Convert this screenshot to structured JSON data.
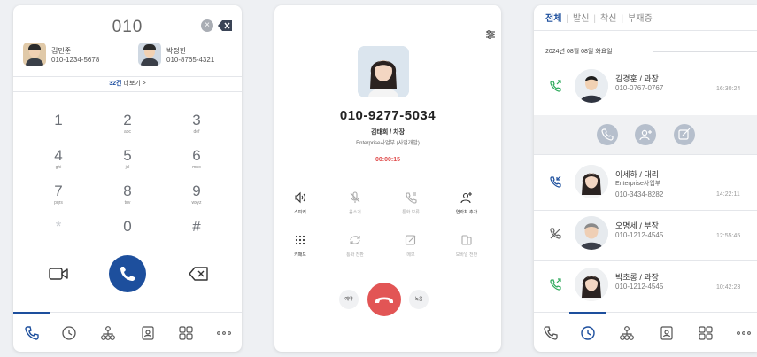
{
  "dialer": {
    "number": "010",
    "contacts": [
      {
        "name": "김민준",
        "number": "010-1234-5678"
      },
      {
        "name": "박정한",
        "number": "010-8765-4321"
      }
    ],
    "more_count": "32건",
    "more_label": " 더보기 >",
    "keys": [
      {
        "digit": "1",
        "letters": ""
      },
      {
        "digit": "2",
        "letters": "abc"
      },
      {
        "digit": "3",
        "letters": "def"
      },
      {
        "digit": "4",
        "letters": "ghi"
      },
      {
        "digit": "5",
        "letters": "jkl"
      },
      {
        "digit": "6",
        "letters": "mno"
      },
      {
        "digit": "7",
        "letters": "pqrs"
      },
      {
        "digit": "8",
        "letters": "tuv"
      },
      {
        "digit": "9",
        "letters": "wxyz"
      },
      {
        "digit": "*",
        "letters": ""
      },
      {
        "digit": "0",
        "letters": ""
      },
      {
        "digit": "#",
        "letters": ""
      }
    ]
  },
  "call": {
    "number": "010-9277-5034",
    "name": "김태희 / 차장",
    "department": "Enterprise사업부 (사업개발)",
    "timer": "00:00:15",
    "controls": [
      {
        "label": "스피커",
        "icon": "speaker-icon"
      },
      {
        "label": "음소거",
        "icon": "mic-off-icon"
      },
      {
        "label": "통화 보류",
        "icon": "hold-icon"
      },
      {
        "label": "연락처 추가",
        "icon": "add-contact-icon"
      },
      {
        "label": "키패드",
        "icon": "keypad-icon"
      },
      {
        "label": "통화 전환",
        "icon": "transfer-icon"
      },
      {
        "label": "메모",
        "icon": "memo-icon"
      },
      {
        "label": "모바일 전환",
        "icon": "mobile-switch-icon"
      }
    ],
    "reserve_label": "예약",
    "record_label": "녹음"
  },
  "history": {
    "tabs": [
      "전체",
      "발신",
      "착신",
      "부재중"
    ],
    "date": "2024년 08월 08일 화요일",
    "rows": [
      {
        "name": "김경훈 / 과장",
        "sub": "",
        "number": "010-0767-0767",
        "time": "16:30:24",
        "direction": "outgoing"
      },
      {
        "name": "이세하 / 대리",
        "sub": "Enterprise사업부",
        "number": "010-3434-8282",
        "time": "14:22:11",
        "direction": "incoming"
      },
      {
        "name": "오명세 / 부장",
        "sub": "",
        "number": "010-1212-4545",
        "time": "12:55:45",
        "direction": "missed"
      },
      {
        "name": "박초롱 / 과장",
        "sub": "",
        "number": "010-1212-4545",
        "time": "10:42:23",
        "direction": "outgoing"
      }
    ]
  },
  "colors": {
    "accent": "#1d4f9d",
    "end_call": "#e25555",
    "incoming": "#1d4f9d",
    "outgoing": "#2eaa5c",
    "timer": "#e04a4a"
  }
}
